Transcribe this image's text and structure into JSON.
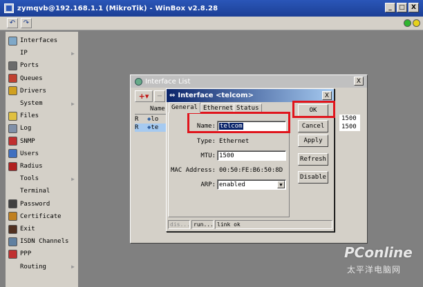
{
  "window": {
    "title": "zymqvb@192.168.1.1 (MikroTik) - WinBox v2.8.28",
    "minimize": "_",
    "maximize": "□",
    "close": "X"
  },
  "toolbar": {
    "undo": "↶",
    "redo": "↷",
    "status_colors": [
      "#2fb52f",
      "#e7d21b"
    ]
  },
  "sidebar": {
    "items": [
      {
        "label": "Interfaces",
        "icon": "interfaces-icon",
        "color": "#7fa8c8",
        "arrow": false
      },
      {
        "label": "IP",
        "icon": "",
        "color": "",
        "arrow": true
      },
      {
        "label": "Ports",
        "icon": "ports-icon",
        "color": "#6b6b6b",
        "arrow": false
      },
      {
        "label": "Queues",
        "icon": "queues-icon",
        "color": "#c04030",
        "arrow": false
      },
      {
        "label": "Drivers",
        "icon": "drivers-icon",
        "color": "#d0a020",
        "arrow": false
      },
      {
        "label": "System",
        "icon": "",
        "color": "",
        "arrow": true
      },
      {
        "label": "Files",
        "icon": "files-icon",
        "color": "#e0c040",
        "arrow": false
      },
      {
        "label": "Log",
        "icon": "log-icon",
        "color": "#8090a8",
        "arrow": false
      },
      {
        "label": "SNMP",
        "icon": "snmp-icon",
        "color": "#c03030",
        "arrow": false
      },
      {
        "label": "Users",
        "icon": "users-icon",
        "color": "#4070c0",
        "arrow": false
      },
      {
        "label": "Radius",
        "icon": "radius-icon",
        "color": "#b02020",
        "arrow": false
      },
      {
        "label": "Tools",
        "icon": "",
        "color": "",
        "arrow": true
      },
      {
        "label": "Terminal",
        "icon": "",
        "color": "",
        "arrow": false
      },
      {
        "label": "Password",
        "icon": "password-icon",
        "color": "#404040",
        "arrow": false
      },
      {
        "label": "Certificate",
        "icon": "certificate-icon",
        "color": "#c08020",
        "arrow": false
      },
      {
        "label": "Exit",
        "icon": "exit-icon",
        "color": "#503020",
        "arrow": false
      },
      {
        "label": "ISDN Channels",
        "icon": "isdn-icon",
        "color": "#6080a0",
        "arrow": false
      },
      {
        "label": "PPP",
        "icon": "ppp-icon",
        "color": "#c03030",
        "arrow": false
      },
      {
        "label": "Routing",
        "icon": "",
        "color": "",
        "arrow": true
      }
    ]
  },
  "interface_list": {
    "title": "Interface List",
    "close": "X",
    "add": "+▾",
    "remove": "−",
    "column_name": "Name",
    "rows": [
      {
        "flag": "R",
        "name": "lo",
        "mtu": "1500"
      },
      {
        "flag": "R",
        "name": "te",
        "mtu": "1500"
      }
    ]
  },
  "dialog": {
    "title": "Interface <telcom>",
    "close": "X",
    "tabs": [
      "General",
      "Ethernet",
      "Status"
    ],
    "fields": {
      "name_label": "Name:",
      "name_value": "telcom",
      "type_label": "Type:",
      "type_value": "Ethernet",
      "mtu_label": "MTU:",
      "mtu_value": "1500",
      "mac_label": "MAC Address:",
      "mac_value": "00:50:FE:B6:50:8D",
      "arp_label": "ARP:",
      "arp_value": "enabled"
    },
    "buttons": {
      "ok": "OK",
      "cancel": "Cancel",
      "apply": "Apply",
      "refresh": "Refresh",
      "disable": "Disable"
    },
    "status": {
      "left": "dis...",
      "middle": "run...",
      "right": "link ok"
    }
  },
  "watermark": {
    "logo": "PConline",
    "sub": "太平洋电脑网"
  }
}
